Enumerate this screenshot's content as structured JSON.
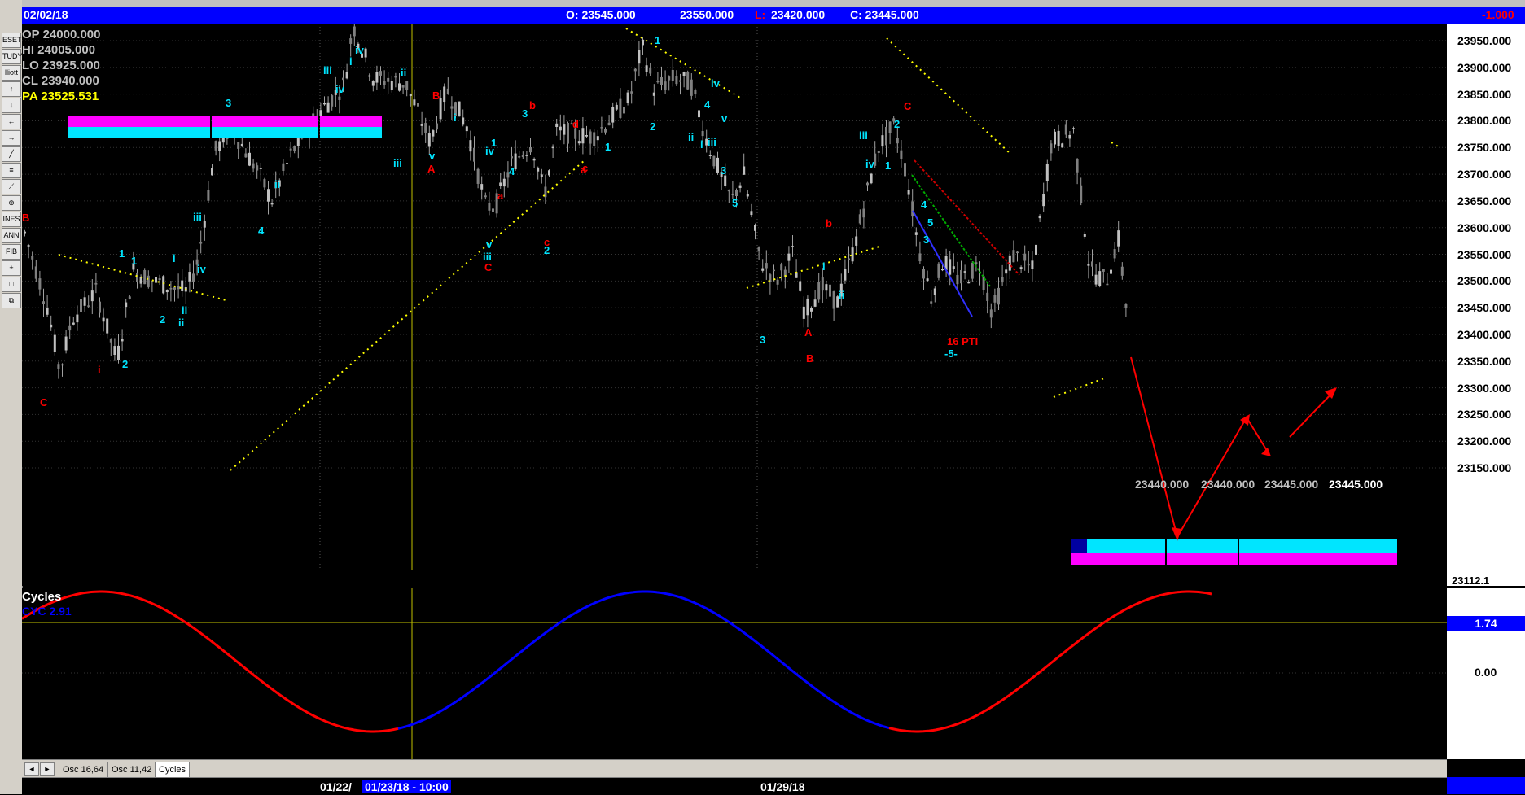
{
  "header": {
    "date": "02/02/18",
    "open": "O: 23545.000",
    "high": "23550.000",
    "low_label": "L:",
    "low": "23420.000",
    "close": "C: 23445.000",
    "change": "-1.000"
  },
  "ohlc_box": {
    "op": "OP  24000.000",
    "hi": "HI   24005.000",
    "lo": "LO   23925.000",
    "cl": "CL   23940.000",
    "pa": "PA   23525.531"
  },
  "price_axis": {
    "labels": [
      "23950.000",
      "23900.000",
      "23850.000",
      "23800.000",
      "23750.000",
      "23700.000",
      "23650.000",
      "23600.000",
      "23550.000",
      "23500.000",
      "23450.000",
      "23400.000",
      "23350.000",
      "23300.000",
      "23250.000",
      "23200.000",
      "23150.000"
    ],
    "bottom_partial": "23112.1"
  },
  "target_labels": [
    "23440.000",
    "23440.000",
    "23445.000",
    "23445.000"
  ],
  "oscillator": {
    "title": "Cycles",
    "sub": "CYC 2.91",
    "value_box": "1.74",
    "zero_label": "0.00"
  },
  "tabs": [
    "Osc 16,64",
    "Osc 11,42",
    "Cycles"
  ],
  "nav": {
    "left": "◄",
    "right": "►"
  },
  "dates": {
    "d1": "01/22/",
    "d2": "01/23/18 - 10:00",
    "d3": "01/29/18"
  },
  "annotations": {
    "pti": "16 PTI",
    "five": "-5-"
  },
  "toolbar_labels": [
    "ESET",
    "TUDY",
    "lliott",
    "INES",
    "ANN",
    "FIB"
  ],
  "wave_labels_cyan": [
    "1",
    "1",
    "2",
    "2",
    "ii",
    "i",
    "iv",
    "iii",
    "3",
    "i",
    "ii",
    "4",
    "iii",
    "iv",
    "ii",
    "iii",
    "i",
    "iv",
    "ii",
    "i",
    "v",
    "iii",
    "iv",
    "1",
    "v",
    "4",
    "3",
    "2",
    "1",
    "2",
    "1",
    "ii",
    "iv",
    "4",
    "i",
    "iii",
    "v",
    "3",
    "5",
    "3",
    "i",
    "ii",
    "iii",
    "iv",
    "1",
    "2",
    "4",
    "5",
    "3",
    "-5-"
  ],
  "wave_labels_red": [
    "B",
    "C",
    "i",
    "B",
    "A",
    "a",
    "c",
    "C",
    "b",
    "d",
    "a",
    "c",
    "b",
    "A",
    "B",
    "C",
    "16 PTI"
  ],
  "colors": {
    "up": "#c0c0c0",
    "down": "#808080",
    "cyan": "#00e5ff",
    "red": "#ff0000",
    "magenta": "#ff00ff",
    "yellow": "#ffff00",
    "blue": "#0000ff",
    "topbar": "#0000ff"
  }
}
